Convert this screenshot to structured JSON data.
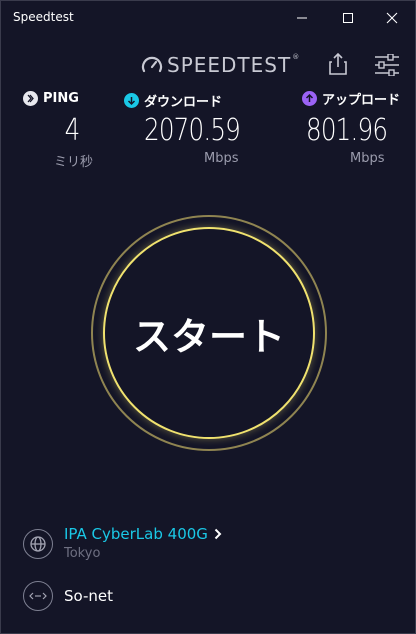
{
  "window": {
    "title": "Speedtest"
  },
  "header": {
    "logo_text": "SPEEDTEST",
    "logo_mark": "®"
  },
  "metrics": {
    "ping": {
      "label": "PING",
      "value": "4",
      "unit": "ミリ秒",
      "icon": "ping-icon"
    },
    "download": {
      "label": "ダウンロード",
      "value": "2070.59",
      "unit": "Mbps",
      "icon": "download-arrow-icon",
      "color": "#1ac8e6"
    },
    "upload": {
      "label": "アップロード",
      "value": "801.96",
      "unit": "Mbps",
      "icon": "upload-arrow-icon",
      "color": "#9b63f5"
    }
  },
  "start": {
    "label": "スタート",
    "ring_color": "#f0e26f"
  },
  "server": {
    "name": "IPA CyberLab 400G",
    "location": "Tokyo",
    "color": "#1ac8e6"
  },
  "isp": {
    "name": "So-net"
  }
}
